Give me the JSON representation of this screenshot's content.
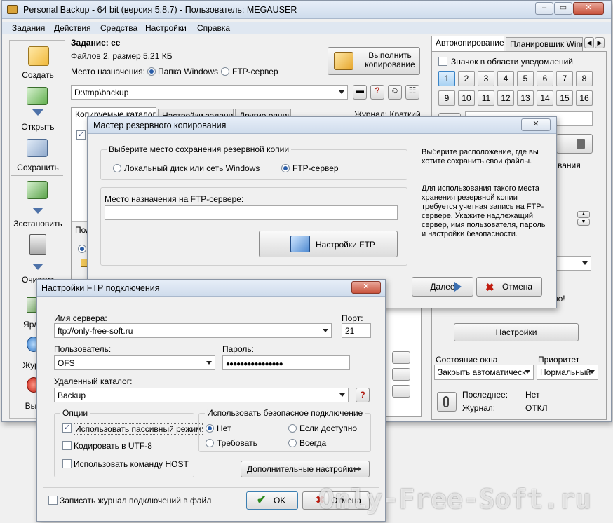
{
  "main": {
    "title": "Personal Backup - 64 bit (версия 5.8.7) - Пользователь: MEGAUSER",
    "menu": [
      "Задания",
      "Действия",
      "Средства",
      "Настройки",
      "Справка"
    ],
    "sidebar": [
      "Создать",
      "Открыть",
      "Сохранить",
      "Зcстановить",
      "Очистит",
      "Ярл",
      "Жур",
      "Вы"
    ],
    "task_label": "Задание: ее",
    "files_info": "Файлов 2, размер 5,21 КБ",
    "dest_label": "Место назначения:",
    "dest_windows": "Папка Windows",
    "dest_ftp": "FTP-сервер",
    "run_button": "Выполнить копирование",
    "path_value": "D:\\tmp\\backup",
    "tabs": [
      "Копируемые каталоги",
      "Настройки задания",
      "Другие опции"
    ],
    "journal_label": "Журнал: Краткий",
    "sub_label": "Под",
    "right_tabs": [
      "Автокопирование",
      "Планировщик Windows"
    ],
    "tray_checkbox": "Значок в области уведомлений",
    "numbers": [
      "1",
      "2",
      "3",
      "4",
      "5",
      "6",
      "7",
      "8",
      "9",
      "10",
      "11",
      "12",
      "13",
      "14",
      "15",
      "16"
    ],
    "settings_button": "Настройки",
    "window_state_label": "Состояние окна",
    "window_state_value": "Закрыть автоматическ",
    "priority_label": "Приоритет",
    "priority_value": "Нормальный",
    "last_label": "Последнее:",
    "last_value": "Нет",
    "journal2_label": "Журнал:",
    "journal2_value": "ОТКЛ",
    "partial_text_1": "вания",
    "partial_text_2": "но!"
  },
  "wizard": {
    "title": "Мастер резервного копирования",
    "choose_label": "Выберите место сохранения резервной копии",
    "local_option": "Локальный диск или сеть Windows",
    "ftp_option": "FTP-сервер",
    "ftp_dest_label": "Место назначения на FTP-сервере:",
    "ftp_settings_button": "Настройки FTP",
    "help_text_1": "Выберите расположение, где вы хотите сохранить свои файлы.",
    "help_text_2": "Для использования такого места хранения резервной копии требуется учетная запись на FTP-сервере. Укажите надлежащий сервер, имя пользователя, пароль и настройки безопасности.",
    "next_button": "Далее",
    "cancel_button": "Отмена"
  },
  "ftp": {
    "title": "Настройки FTP подключения",
    "server_label": "Имя сервера:",
    "server_value": "ftp://only-free-soft.ru",
    "port_label": "Порт:",
    "port_value": "21",
    "user_label": "Пользователь:",
    "user_value": "OFS",
    "password_label": "Пароль:",
    "password_value": "●●●●●●●●●●●●●●●●",
    "remote_dir_label": "Удаленный каталог:",
    "remote_dir_value": "Backup",
    "options_title": "Опции",
    "opt_passive": "Использовать пассивный режим",
    "opt_utf8": "Кодировать в UTF-8",
    "opt_host": "Использовать команду HOST",
    "secure_title": "Использовать безопасное подключение",
    "sec_no": "Нет",
    "sec_if_available": "Если доступно",
    "sec_require": "Требовать",
    "sec_always": "Всегда",
    "advanced_button": "Дополнительные настройки",
    "log_checkbox": "Записать журнал подключений в файл",
    "ok_button": "OK",
    "cancel_button": "Отмена"
  },
  "watermark": "Only-Free-Soft.ru",
  "colors": {
    "title_bar": "#cfdcec",
    "accent": "#2a5da8",
    "close_red": "#c8523c"
  }
}
